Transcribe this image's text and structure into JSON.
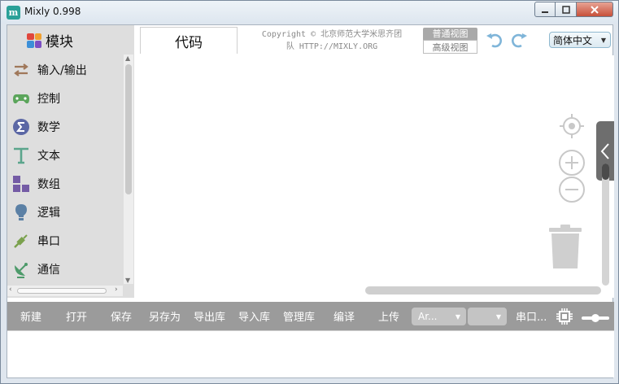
{
  "window": {
    "title": "Mixly 0.998",
    "icon_letter": "m"
  },
  "toolbox": {
    "title": "模块",
    "categories": [
      {
        "label": "输入/输出",
        "icon": "arrows-io-icon",
        "color": "#a0785a"
      },
      {
        "label": "控制",
        "icon": "gamepad-icon",
        "color": "#5ba55b"
      },
      {
        "label": "数学",
        "icon": "math-sigma-icon",
        "color": "#5b67a5"
      },
      {
        "label": "文本",
        "icon": "text-t-icon",
        "color": "#5ba58c"
      },
      {
        "label": "数组",
        "icon": "blocks-icon",
        "color": "#745ba5"
      },
      {
        "label": "逻辑",
        "icon": "lightbulb-icon",
        "color": "#5b80a5"
      },
      {
        "label": "串口",
        "icon": "usb-plug-icon",
        "color": "#7aa14d"
      },
      {
        "label": "通信",
        "icon": "satellite-dish-icon",
        "color": "#4d9a6a"
      }
    ]
  },
  "header": {
    "code_tab": "代码",
    "copyright_line1": "Copyright © 北京师范大学米思齐团",
    "copyright_line2": "队 HTTP://MIXLY.ORG",
    "view_normal": "普通视图",
    "view_advanced": "高级视图",
    "language": "简体中文"
  },
  "toolbar": {
    "new": "新建",
    "open": "打开",
    "save": "保存",
    "save_as": "另存为",
    "export_lib": "导出库",
    "import_lib": "导入库",
    "manage_lib": "管理库",
    "compile": "编译",
    "upload": "上传",
    "board": "Ar...",
    "port": "",
    "serial_monitor": "串口..."
  },
  "colors": {
    "toolbox_bg": "#dedede",
    "toolbar_bg": "#9b9b9b",
    "undo_redo": "#7fb5d9"
  }
}
